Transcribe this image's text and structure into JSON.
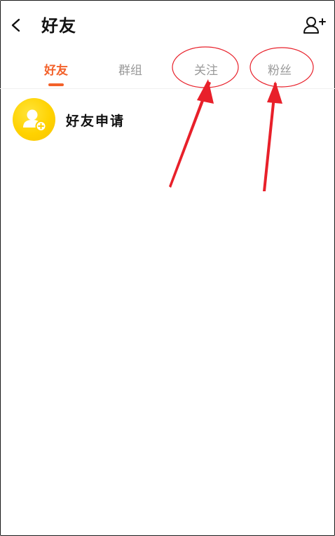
{
  "header": {
    "title": "好友",
    "back_icon": "chevron-left-icon",
    "add_friend_icon": "add-user-icon"
  },
  "tabs": [
    {
      "label": "好友",
      "active": true
    },
    {
      "label": "群组",
      "active": false
    },
    {
      "label": "关注",
      "active": false
    },
    {
      "label": "粉丝",
      "active": false
    }
  ],
  "list": {
    "items": [
      {
        "label": "好友申请",
        "icon": "add-user-avatar-icon"
      }
    ]
  },
  "colors": {
    "accent": "#f3612a",
    "avatar": "#ffd200",
    "annotation": "#e8202a",
    "inactive_tab": "#9a9a9a"
  }
}
